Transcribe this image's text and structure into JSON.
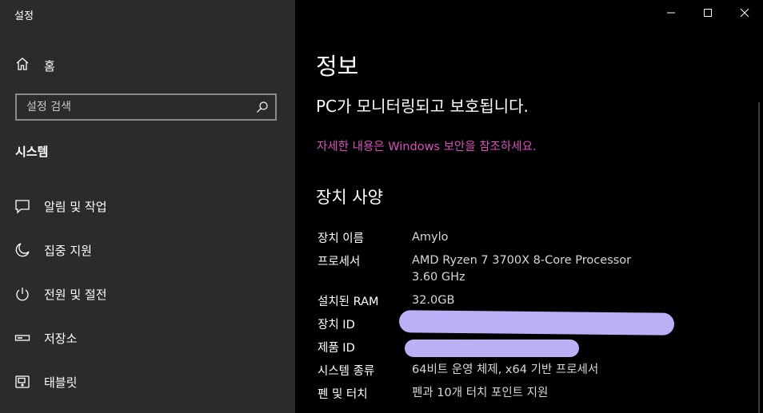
{
  "app": {
    "title": "설정"
  },
  "sidebar": {
    "home_label": "홈",
    "search_placeholder": "설정 검색",
    "section_title": "시스템",
    "items": [
      {
        "label": "알림 및 작업",
        "icon": "notification-icon"
      },
      {
        "label": "집중 지원",
        "icon": "moon-icon"
      },
      {
        "label": "전원 및 절전",
        "icon": "power-icon"
      },
      {
        "label": "저장소",
        "icon": "storage-icon"
      },
      {
        "label": "태블릿",
        "icon": "tablet-icon"
      }
    ]
  },
  "main": {
    "title": "정보",
    "protection_status": "PC가 모니터링되고 보호됩니다.",
    "security_link": "자세한 내용은 Windows 보안을 참조하세요.",
    "specs_title": "장치 사양",
    "specs": [
      {
        "key": "장치 이름",
        "value": "Amylo"
      },
      {
        "key": "프로세서",
        "value": "AMD Ryzen 7 3700X 8-Core Processor",
        "value2": "3.60 GHz"
      },
      {
        "key": "설치된 RAM",
        "value": "32.0GB"
      },
      {
        "key": "장치 ID",
        "value": ""
      },
      {
        "key": "제품 ID",
        "value": ""
      },
      {
        "key": "시스템 종류",
        "value": "64비트 운영 체제, x64 기반 프로세서"
      },
      {
        "key": "펜 및 터치",
        "value": "펜과 10개 터치 포인트 지원"
      }
    ]
  },
  "colors": {
    "sidebar_bg": "#2b2b2b",
    "main_bg": "#000000",
    "link": "#d94fbd",
    "redaction": "#b9b0f6"
  }
}
